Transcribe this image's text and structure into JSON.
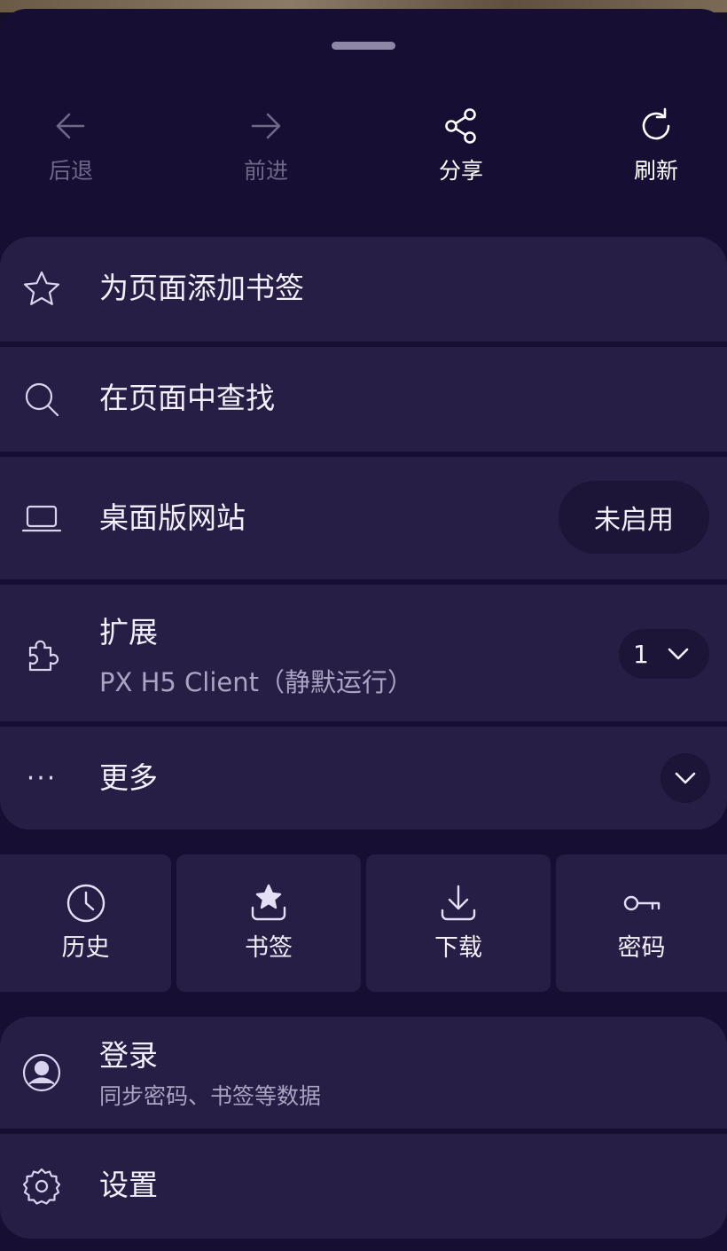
{
  "nav": {
    "back": {
      "label": "后退",
      "icon": "arrow-left-icon",
      "enabled": false
    },
    "forward": {
      "label": "前进",
      "icon": "arrow-right-icon",
      "enabled": false
    },
    "share": {
      "label": "分享",
      "icon": "share-icon",
      "enabled": true
    },
    "refresh": {
      "label": "刷新",
      "icon": "refresh-icon",
      "enabled": true
    }
  },
  "menu": {
    "bookmark_page": {
      "label": "为页面添加书签",
      "icon": "star-outline-icon"
    },
    "find_in_page": {
      "label": "在页面中查找",
      "icon": "search-icon"
    },
    "desktop_site": {
      "label": "桌面版网站",
      "icon": "laptop-icon",
      "status": "未启用"
    },
    "extensions": {
      "label": "扩展",
      "icon": "puzzle-icon",
      "subtitle": "PX H5 Client（静默运行）",
      "count": "1"
    },
    "more": {
      "label": "更多",
      "icon": "more-dots-icon",
      "dots": "···"
    }
  },
  "tiles": [
    {
      "label": "历史",
      "icon": "clock-icon"
    },
    {
      "label": "书签",
      "icon": "bookmark-star-icon"
    },
    {
      "label": "下载",
      "icon": "download-icon"
    },
    {
      "label": "密码",
      "icon": "key-icon"
    }
  ],
  "account": {
    "signin": {
      "label": "登录",
      "subtitle": "同步密码、书签等数据",
      "icon": "account-circle-icon"
    },
    "settings": {
      "label": "设置",
      "icon": "gear-icon"
    }
  },
  "colors": {
    "sheet_bg": "#170f33",
    "item_bg": "#271e45",
    "pill_bg": "#1c1537",
    "text_primary": "#f3f0fb",
    "text_secondary": "#aaa3c2",
    "text_disabled": "#6f6888"
  }
}
